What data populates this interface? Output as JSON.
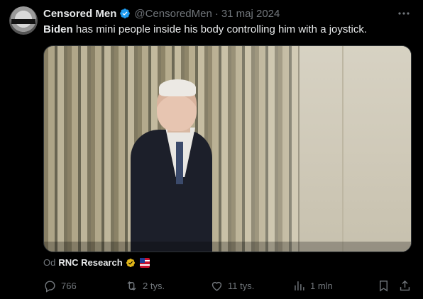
{
  "tweet": {
    "author_name": "Censored Men",
    "handle": "@CensoredMen",
    "separator": "·",
    "date": "31 maj 2024",
    "text_bold": "Biden",
    "text_rest": " has mini people inside his body controlling him with a joystick."
  },
  "avatar": {
    "label": "CENSORED"
  },
  "media": {
    "type": "video",
    "description": "video-still"
  },
  "source": {
    "prefix": "Od",
    "account": "RNC Research",
    "badge_icon": "gold-verified-icon",
    "flag_icon": "flag-icon"
  },
  "actions": {
    "replies": "766",
    "reposts": "2 tys.",
    "likes": "11 tys.",
    "views": "1 mln"
  },
  "colors": {
    "background": "#000000",
    "text": "#e7e9ea",
    "muted": "#71767b",
    "verified": "#1d9bf0",
    "gold": "#e2b719"
  }
}
